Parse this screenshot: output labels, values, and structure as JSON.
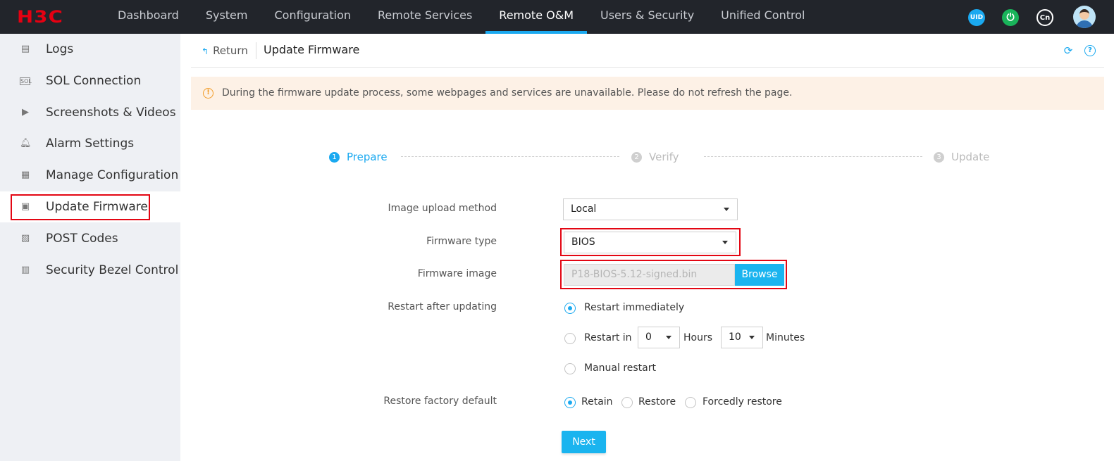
{
  "topbar": {
    "logo": "H3C",
    "nav": [
      "Dashboard",
      "System",
      "Configuration",
      "Remote Services",
      "Remote O&M",
      "Users & Security",
      "Unified Control"
    ],
    "active_nav": "Remote O&M",
    "uid_label": "UID",
    "power_icon": "power-icon",
    "lang_label": "Cn"
  },
  "sidebar": {
    "items": [
      {
        "label": "Logs",
        "icon": "logs-icon"
      },
      {
        "label": "SOL Connection",
        "icon": "sol-icon"
      },
      {
        "label": "Screenshots & Videos",
        "icon": "video-icon"
      },
      {
        "label": "Alarm Settings",
        "icon": "bell-icon"
      },
      {
        "label": "Manage Configuration",
        "icon": "config-icon"
      },
      {
        "label": "Update Firmware",
        "icon": "chip-icon"
      },
      {
        "label": "POST Codes",
        "icon": "document-search-icon"
      },
      {
        "label": "Security Bezel Control",
        "icon": "bezel-icon"
      }
    ],
    "active": "Update Firmware"
  },
  "header": {
    "return_label": "Return",
    "title": "Update Firmware"
  },
  "notice": "During the firmware update process, some webpages and services are unavailable. Please do not refresh the page.",
  "steps": [
    {
      "num": "1",
      "label": "Prepare"
    },
    {
      "num": "2",
      "label": "Verify"
    },
    {
      "num": "3",
      "label": "Update"
    }
  ],
  "form": {
    "upload_method_label": "Image upload method",
    "upload_method_value": "Local",
    "firmware_type_label": "Firmware type",
    "firmware_type_value": "BIOS",
    "firmware_image_label": "Firmware image",
    "firmware_image_value": "P18-BIOS-5.12-signed.bin",
    "browse_label": "Browse",
    "restart_label": "Restart after updating",
    "restart_options": {
      "immediately": "Restart immediately",
      "restart_in": "Restart in",
      "hours_value": "0",
      "hours_unit": "Hours",
      "minutes_value": "10",
      "minutes_unit": "Minutes",
      "manual": "Manual restart"
    },
    "restart_selected": "immediately",
    "factory_label": "Restore factory default",
    "factory_options": {
      "retain": "Retain",
      "restore": "Restore",
      "forced": "Forcedly restore"
    },
    "factory_selected": "retain",
    "next_label": "Next"
  },
  "colors": {
    "accent": "#1aa9f0",
    "topbar": "#22252b",
    "logo": "#e60012",
    "highlight": "#e30613",
    "notice_bg": "#fdf1e6"
  }
}
